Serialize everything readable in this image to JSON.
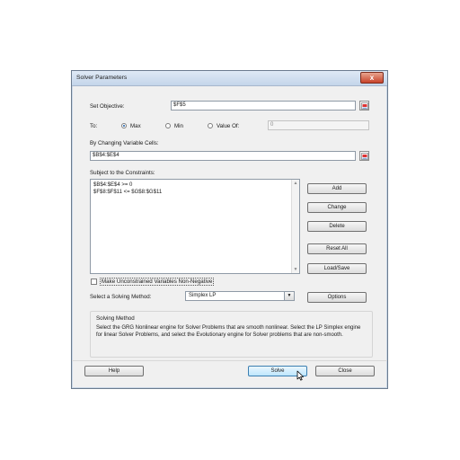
{
  "window": {
    "title": "Solver Parameters",
    "close_label": "x"
  },
  "objective": {
    "label": "Set Objective:",
    "value": "$F$5"
  },
  "to": {
    "label": "To:",
    "max_label": "Max",
    "min_label": "Min",
    "value_of_label": "Value Of:",
    "value_of_input": "0",
    "selected": "Max"
  },
  "changing": {
    "label": "By Changing Variable Cells:",
    "value": "$B$4:$E$4"
  },
  "constraints": {
    "label": "Subject to the Constraints:",
    "items": [
      "$B$4:$E$4 >= 0",
      "$F$8:$F$11 <= $G$8:$G$11"
    ]
  },
  "buttons": {
    "add": "Add",
    "change": "Change",
    "delete": "Delete",
    "reset_all": "Reset All",
    "load_save": "Load/Save",
    "options": "Options",
    "help": "Help",
    "solve": "Solve",
    "close": "Close"
  },
  "nonnegative": {
    "label": "Make Unconstrained Variables Non-Negative",
    "checked": false
  },
  "method": {
    "label": "Select a Solving Method:",
    "value": "Simplex LP"
  },
  "solving_method": {
    "title": "Solving Method",
    "description": "Select the GRG Nonlinear engine for Solver Problems that are smooth nonlinear. Select the LP Simplex engine for linear Solver Problems, and select the Evolutionary engine for Solver problems that are non-smooth."
  },
  "colors": {
    "title_bar": "#c4d5ea",
    "dialog_bg": "#f0f0f0",
    "focus_blue": "#3c7fb1"
  }
}
